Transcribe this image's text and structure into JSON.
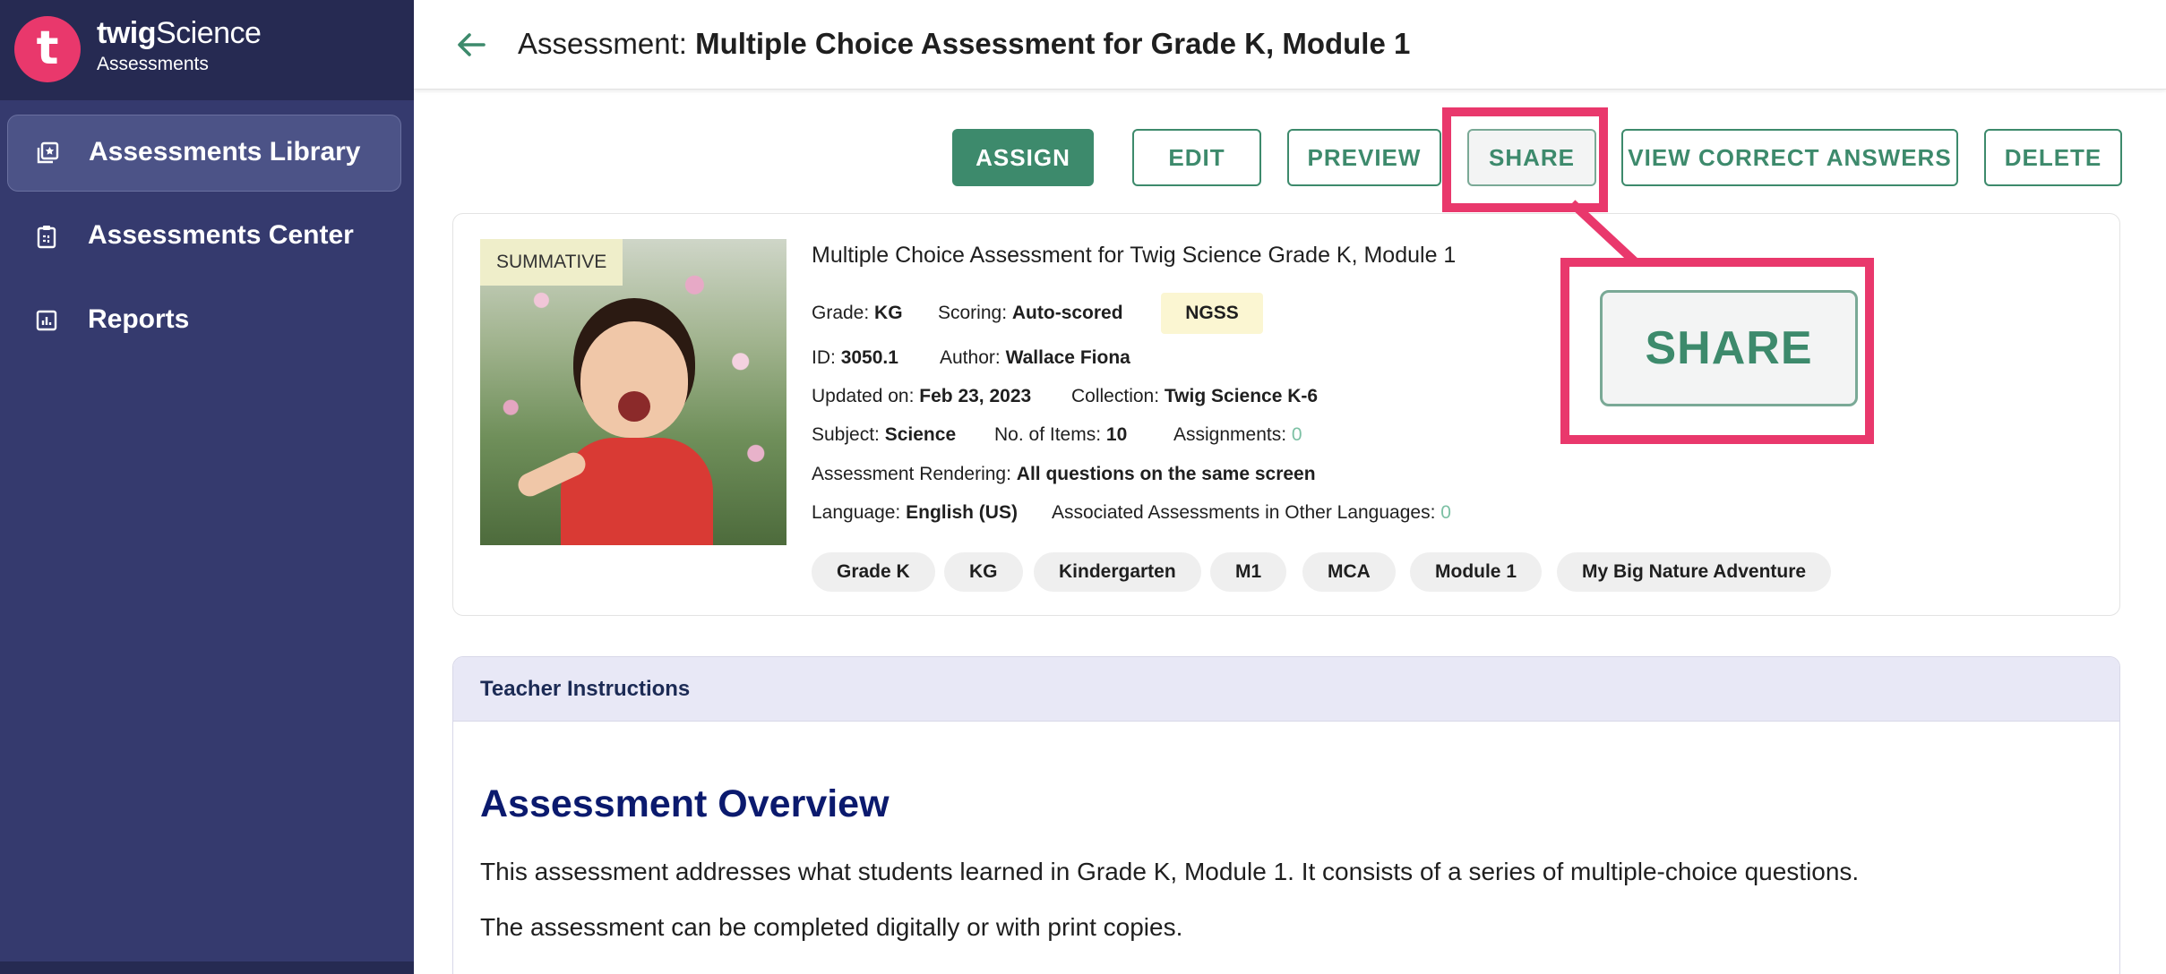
{
  "sidebar": {
    "logo_letter": "t",
    "brand_bold": "twig",
    "brand_light": "Science",
    "subtitle": "Assessments",
    "items": [
      {
        "label": "Assessments Library",
        "icon": "library-icon",
        "active": true
      },
      {
        "label": "Assessments Center",
        "icon": "clipboard-icon",
        "active": false
      },
      {
        "label": "Reports",
        "icon": "bar-chart-icon",
        "active": false
      }
    ]
  },
  "header": {
    "prefix": "Assessment: ",
    "title": "Multiple Choice Assessment for Grade K, Module 1"
  },
  "actions": {
    "assign": "ASSIGN",
    "edit": "EDIT",
    "preview": "PREVIEW",
    "share": "SHARE",
    "view_correct_answers": "VIEW CORRECT ANSWERS",
    "delete": "DELETE",
    "share_zoom": "SHARE"
  },
  "assessment": {
    "badge": "SUMMATIVE",
    "title": "Multiple Choice Assessment for Twig Science Grade K, Module 1",
    "grade_label": "Grade:",
    "grade": "KG",
    "scoring_label": "Scoring:",
    "scoring": "Auto-scored",
    "standard": "NGSS",
    "id_label": "ID:",
    "id": "3050.1",
    "author_label": "Author:",
    "author": "Wallace Fiona",
    "updated_label": "Updated on:",
    "updated": "Feb 23, 2023",
    "collection_label": "Collection:",
    "collection": "Twig Science K-6",
    "subject_label": "Subject:",
    "subject": "Science",
    "items_label": "No. of Items:",
    "items": "10",
    "assignments_label": "Assignments:",
    "assignments": "0",
    "rendering_label": "Assessment Rendering:",
    "rendering": "All questions on the same screen",
    "language_label": "Language:",
    "language": "English (US)",
    "associated_label": "Associated Assessments in Other Languages:",
    "associated": "0",
    "tags": [
      "Grade K",
      "KG",
      "Kindergarten",
      "M1",
      "MCA",
      "Module 1",
      "My Big Nature Adventure"
    ]
  },
  "instructions": {
    "header": "Teacher Instructions",
    "overview_title": "Assessment Overview",
    "paragraph1": "This assessment addresses what students learned in Grade K, Module 1. It consists of a series of multiple-choice questions.",
    "paragraph2": "The assessment can be completed digitally or with print copies."
  },
  "colors": {
    "sidebar": "#353a6e",
    "accent_green": "#3d8a6c",
    "highlight_pink": "#e9386c"
  }
}
